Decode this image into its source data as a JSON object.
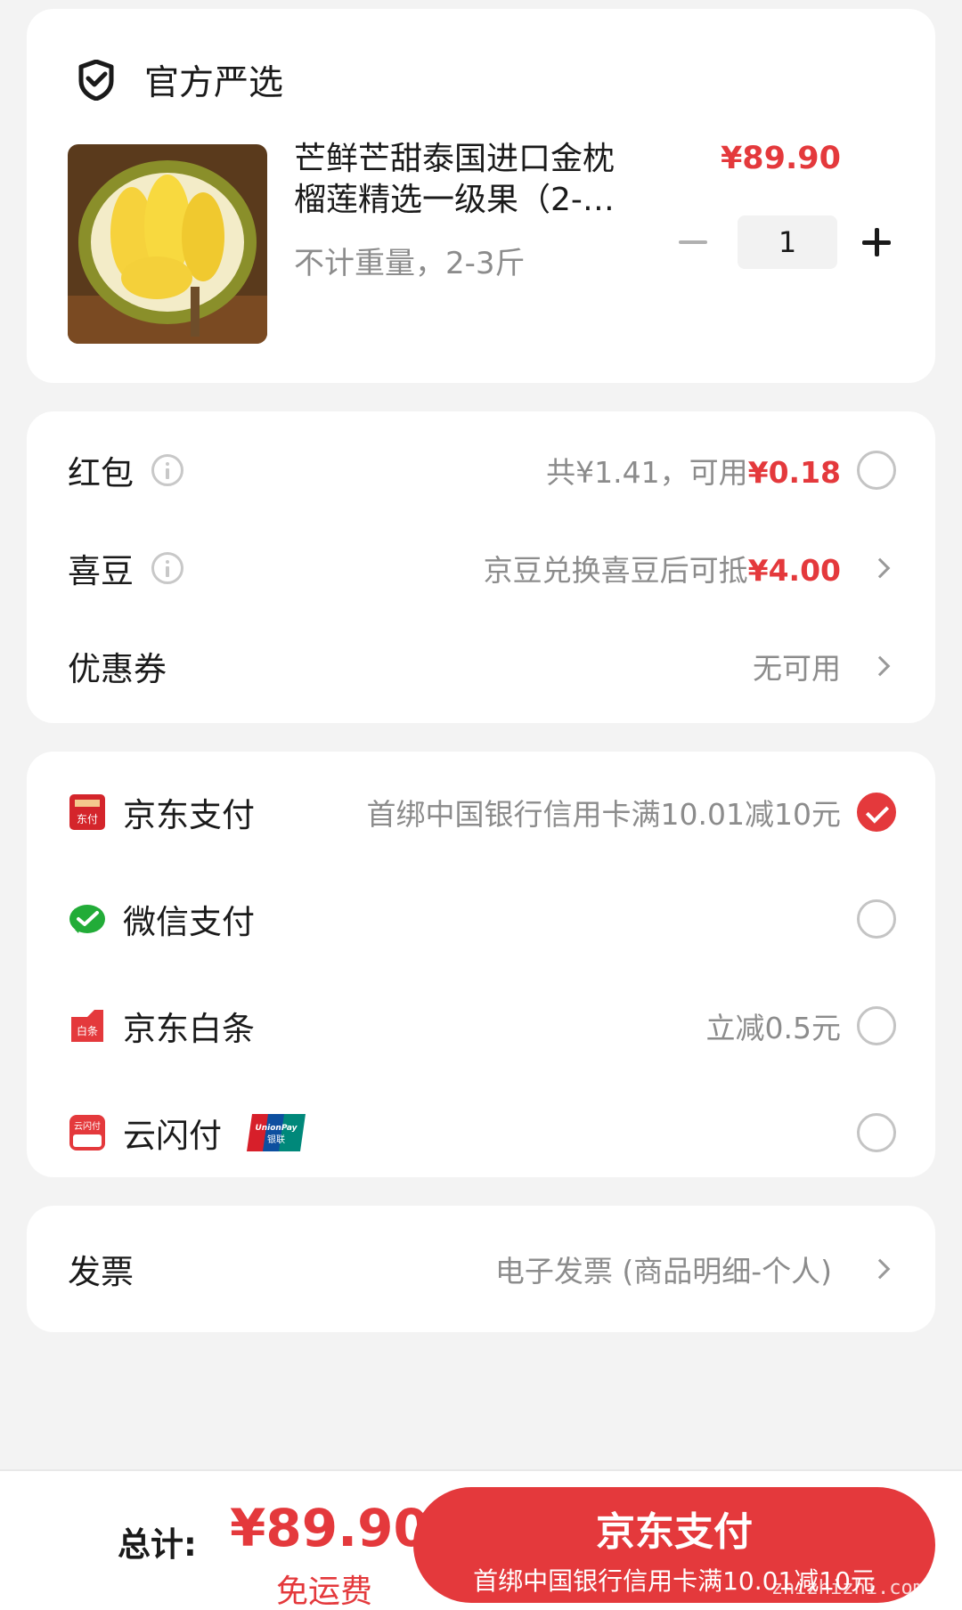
{
  "store": {
    "name": "官方严选"
  },
  "product": {
    "title_line1": "芒鲜芒甜泰国进口金枕",
    "title_line2": "榴莲精选一级果（2-…",
    "spec": "不计重量，2-3斤",
    "price": "¥89.90",
    "quantity": "1"
  },
  "discounts": [
    {
      "label": "红包",
      "value_prefix": "共¥1.41，可用",
      "value_highlight": "¥0.18"
    },
    {
      "label": "喜豆",
      "value_prefix": "京豆兑换喜豆后可抵",
      "value_highlight": "¥4.00"
    },
    {
      "label": "优惠券",
      "value": "无可用"
    }
  ],
  "payments": [
    {
      "label": "京东支付",
      "promo": "首绑中国银行信用卡满10.01减10元",
      "selected": true,
      "icon": "jd-pay-icon",
      "icon_text": "东付"
    },
    {
      "label": "微信支付",
      "promo": "",
      "selected": false,
      "icon": "wechat-pay-icon"
    },
    {
      "label": "京东白条",
      "promo": "立减0.5元",
      "selected": false,
      "icon": "jd-baitiao-icon",
      "icon_text": "白条"
    },
    {
      "label": "云闪付",
      "promo": "",
      "selected": false,
      "icon": "yunshanfu-icon",
      "icon_text": "云闪付",
      "badge_text": "UnionPay 银联"
    }
  ],
  "invoice": {
    "label": "发票",
    "value": "电子发票 (商品明细-个人)"
  },
  "bottom_bar": {
    "total_label": "总计:",
    "total_price": "¥89.90",
    "shipping": "免运费",
    "pay_button_label": "京东支付",
    "pay_button_sub": "首绑中国银行信用卡满10.01减10元",
    "watermark": "zhizhizhi.com"
  },
  "colors": {
    "accent": "#e4393c",
    "background": "#f3f3f3",
    "muted": "#8c8c8c"
  }
}
